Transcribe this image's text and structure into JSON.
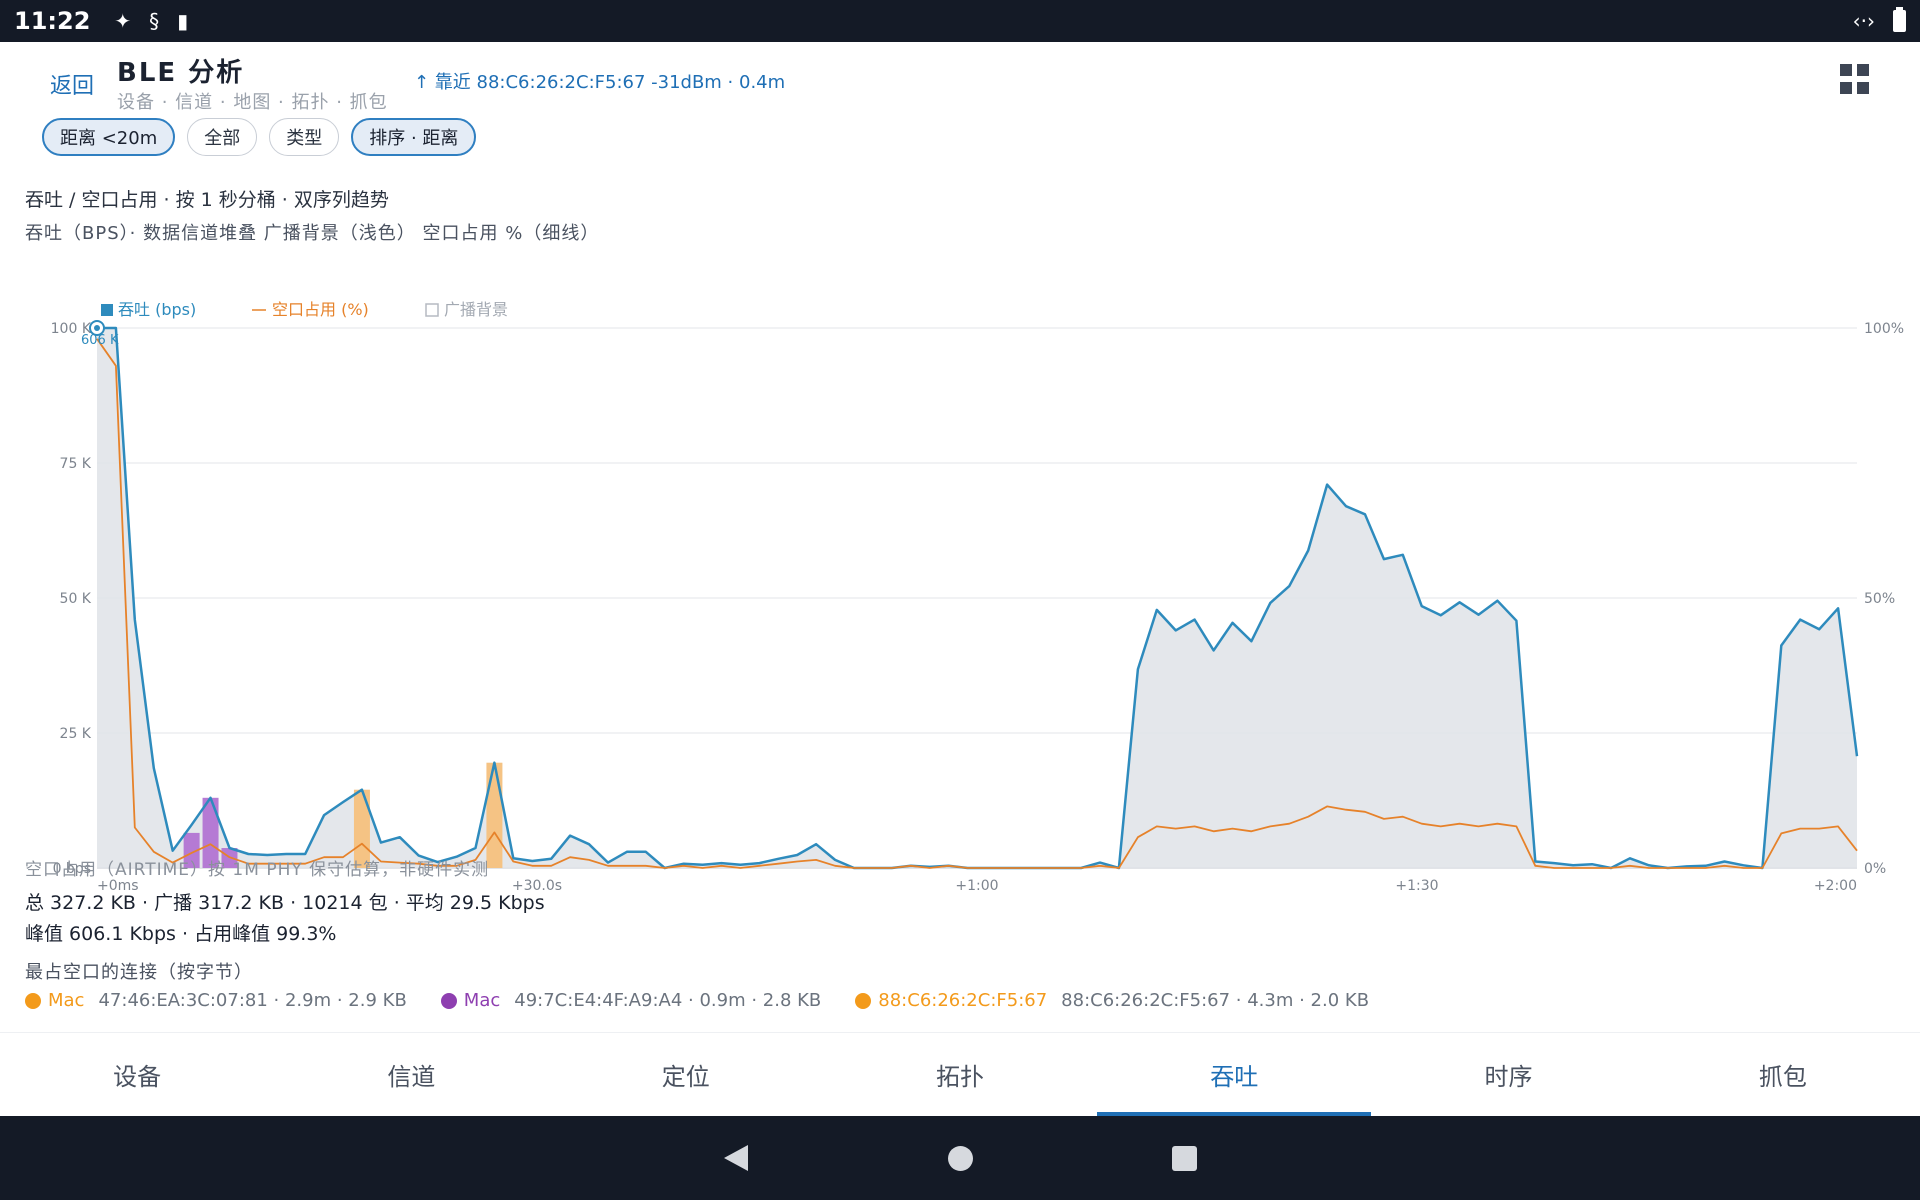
{
  "status": {
    "time": "11:22"
  },
  "header": {
    "back_label": "返回",
    "title": "BLE 分析",
    "breadcrumb": "设备 · 信道 · 地图 · 拓扑 · 抓包",
    "nearby": "↑ 靠近 88:C6:26:2C:F5:67 -31dBm · 0.4m"
  },
  "filters": [
    {
      "label": "距离 <20m",
      "active": true
    },
    {
      "label": "全部",
      "active": false
    },
    {
      "label": "类型",
      "active": false
    },
    {
      "label": "排序 · 距离",
      "active": true
    }
  ],
  "chart_title": "吞吐 / 空口占用 · 按 1 秒分桶 · 双序列趋势",
  "chart_subtitle": "吞吐（BPS）· 数据信道堆叠 广播背景（浅色） 空口占用 %（细线）",
  "chart_data": {
    "type": "line",
    "legend": [
      {
        "name": "吞吐 (bps)",
        "color": "#2e8bbd"
      },
      {
        "name": "空口占用 (%)",
        "color": "#e6822a"
      },
      {
        "name": "广播背景",
        "color": "#c9ced6"
      }
    ],
    "legend_placement": "top-left",
    "x_ticks": [
      "+0ms",
      "+30.0s",
      "+1:00",
      "+1:30",
      "+2:00"
    ],
    "x_range_s": [
      0,
      120
    ],
    "y_left_ticks": [
      "0 bps",
      "25 K",
      "50 K",
      "75 K",
      "100 K"
    ],
    "y_left_range": [
      0,
      100000
    ],
    "y_right_ticks": [
      "0%",
      "50%",
      "100%"
    ],
    "y_right_range": [
      0,
      100
    ],
    "peak_label": "606 K",
    "grid": true,
    "throughput_bps": [
      100000,
      100000,
      46000,
      18500,
      3200,
      8000,
      13000,
      3700,
      2600,
      2400,
      2600,
      2600,
      9800,
      12200,
      14500,
      4700,
      5700,
      2300,
      1100,
      2100,
      3700,
      19500,
      1800,
      1300,
      1700,
      6000,
      4400,
      1000,
      3000,
      3000,
      0,
      800,
      600,
      900,
      600,
      900,
      1700,
      2400,
      4400,
      1500,
      0,
      0,
      0,
      400,
      200,
      400,
      0,
      0,
      0,
      0,
      0,
      0,
      0,
      1000,
      0,
      36800,
      47800,
      44000,
      46000,
      40300,
      45400,
      42000,
      49100,
      52200,
      58800,
      71000,
      67000,
      65500,
      57200,
      58000,
      48500,
      46800,
      49200,
      46900,
      49500,
      45800,
      1200,
      900,
      500,
      700,
      0,
      1800,
      500,
      0,
      300,
      400,
      1200,
      500,
      0,
      41200,
      46000,
      44200,
      48100,
      20700
    ],
    "airtime_pct": [
      98,
      93,
      7.5,
      3,
      1,
      2.8,
      4.4,
      2,
      0.8,
      0.8,
      0.8,
      0.8,
      2,
      2,
      4.5,
      1.2,
      1,
      0.8,
      0.4,
      0.4,
      1.5,
      6.6,
      1.2,
      0.4,
      0.4,
      2,
      1.5,
      0.4,
      0.4,
      0.4,
      0,
      0.4,
      0,
      0.4,
      0,
      0.4,
      0.8,
      1.2,
      1.5,
      0.4,
      0,
      0,
      0,
      0.4,
      0,
      0.4,
      0,
      0,
      0,
      0,
      0,
      0,
      0,
      0.4,
      0,
      5.7,
      7.7,
      7.3,
      7.7,
      6.8,
      7.3,
      6.8,
      7.7,
      8.2,
      9.5,
      11.4,
      10.8,
      10.4,
      9.1,
      9.5,
      8.2,
      7.7,
      8.2,
      7.7,
      8.2,
      7.7,
      0.4,
      0,
      0,
      0,
      0,
      0.4,
      0,
      0,
      0,
      0,
      0.4,
      0,
      0,
      6.4,
      7.3,
      7.3,
      7.7,
      3.2
    ],
    "data_bars": [
      {
        "t": 5,
        "value": 6500,
        "color": "#b57ad4"
      },
      {
        "t": 6,
        "value": 13000,
        "color": "#b57ad4"
      },
      {
        "t": 7,
        "value": 3700,
        "color": "#b57ad4"
      },
      {
        "t": 14,
        "value": 14500,
        "color": "#f5c384"
      },
      {
        "t": 21,
        "value": 19500,
        "color": "#f5c384"
      }
    ]
  },
  "airtime_note": "空口占用（AIRTIME）按 1M PHY 保守估算，非硬件实测",
  "stats_line1": "总 327.2 KB · 广播 317.2 KB · 10214 包 · 平均 29.5 Kbps",
  "stats_line2": "峰值 606.1 Kbps · 占用峰值 99.3%",
  "top_title": "最占空口的连接（按字节）",
  "top_connections": [
    {
      "name": "Mac",
      "meta": "47:46:EA:3C:07:81 · 2.9m · 2.9 KB",
      "color": "#f39a1b"
    },
    {
      "name": "Mac",
      "meta": "49:7C:E4:4F:A9:A4 · 0.9m · 2.8 KB",
      "color": "#8e3fb0"
    },
    {
      "name": "88:C6:26:2C:F5:67",
      "meta": "88:C6:26:2C:F5:67 · 4.3m · 2.0 KB",
      "color": "#f39a1b"
    }
  ],
  "tabs": [
    {
      "label": "设备",
      "active": false
    },
    {
      "label": "信道",
      "active": false
    },
    {
      "label": "定位",
      "active": false
    },
    {
      "label": "拓扑",
      "active": false
    },
    {
      "label": "吞吐",
      "active": true
    },
    {
      "label": "时序",
      "active": false
    },
    {
      "label": "抓包",
      "active": false
    }
  ]
}
